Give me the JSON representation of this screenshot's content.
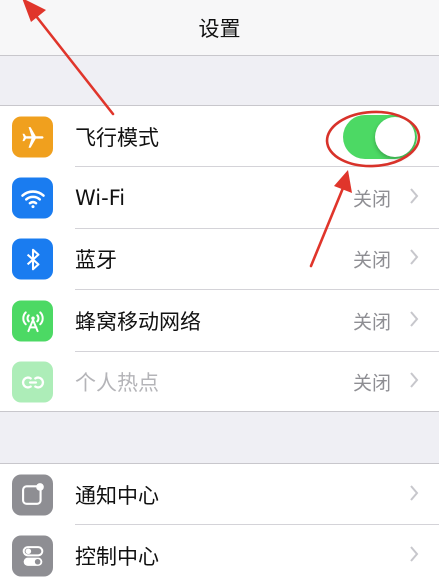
{
  "navbar": {
    "title": "设置"
  },
  "group1": {
    "items": [
      {
        "label": "飞行模式",
        "icon": "airplane-icon",
        "icon_color": "#f0a01e",
        "toggle_on": true
      },
      {
        "label": "Wi-Fi",
        "icon": "wifi-icon",
        "icon_color": "#1a7cf0",
        "value": "关闭"
      },
      {
        "label": "蓝牙",
        "icon": "bluetooth-icon",
        "icon_color": "#1a7cf0",
        "value": "关闭"
      },
      {
        "label": "蜂窝移动网络",
        "icon": "cellular-icon",
        "icon_color": "#4cd964",
        "value": "关闭"
      },
      {
        "label": "个人热点",
        "icon": "hotspot-icon",
        "icon_color": "#4cd964",
        "value": "关闭",
        "disabled": true
      }
    ]
  },
  "group2": {
    "items": [
      {
        "label": "通知中心",
        "icon": "notification-center-icon",
        "icon_color": "#8e8e93"
      },
      {
        "label": "控制中心",
        "icon": "control-center-icon",
        "icon_color": "#8e8e93"
      }
    ]
  },
  "colors": {
    "toggle_on": "#4cd964",
    "annotation_red": "#e0352b"
  }
}
